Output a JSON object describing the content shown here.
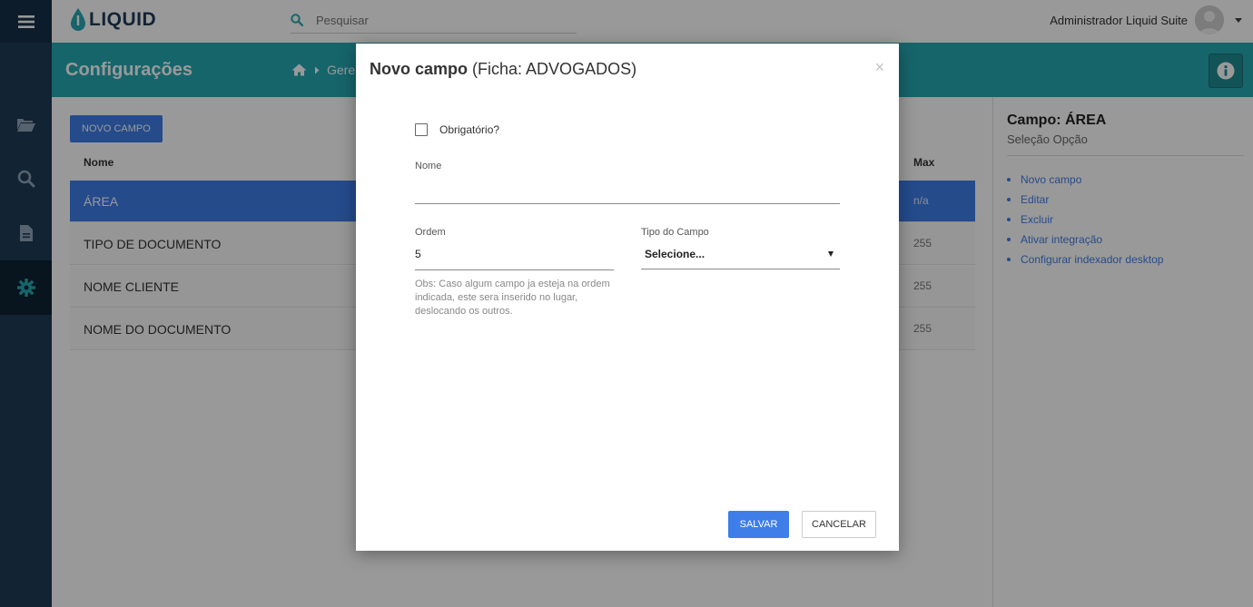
{
  "app": {
    "logo_text": "LIQUID"
  },
  "search": {
    "placeholder": "Pesquisar"
  },
  "user": {
    "name": "Administrador Liquid Suite"
  },
  "header": {
    "title": "Configurações",
    "breadcrumb_item": "Gere"
  },
  "main": {
    "new_field_button": "NOVO CAMPO",
    "columns": {
      "name": "Nome",
      "max": "Max"
    },
    "rows": [
      {
        "name": "ÁREA",
        "max": "n/a",
        "selected": true
      },
      {
        "name": "TIPO DE DOCUMENTO",
        "max": "255"
      },
      {
        "name": "NOME CLIENTE",
        "max": "255"
      },
      {
        "name": "NOME DO DOCUMENTO",
        "max": "255"
      }
    ]
  },
  "right_panel": {
    "title": "Campo: ÁREA",
    "subtitle": "Seleção Opção",
    "actions": [
      "Novo campo",
      "Editar",
      "Excluir",
      "Ativar integração",
      "Configurar indexador desktop"
    ]
  },
  "modal": {
    "title_bold": "Novo campo",
    "title_rest": " (Ficha: ADVOGADOS)",
    "close": "×",
    "required_label": "Obrigatório?",
    "name_label": "Nome",
    "name_value": "",
    "order_label": "Ordem",
    "order_value": "5",
    "type_label": "Tipo do Campo",
    "type_value": "Selecione...",
    "obs": "Obs: Caso algum campo ja esteja na ordem indicada, este sera inserido no lugar, deslocando os outros.",
    "save_button": "SALVAR",
    "cancel_button": "CANCELAR"
  },
  "colors": {
    "accent": "#3f7ee8",
    "header": "#25a8b3",
    "sidebar": "#1e3b56"
  },
  "icons": [
    "menu-icon",
    "folder-icon",
    "search-icon",
    "document-icon",
    "gear-icon",
    "home-icon",
    "chevron-right-icon",
    "info-icon",
    "close-icon"
  ]
}
